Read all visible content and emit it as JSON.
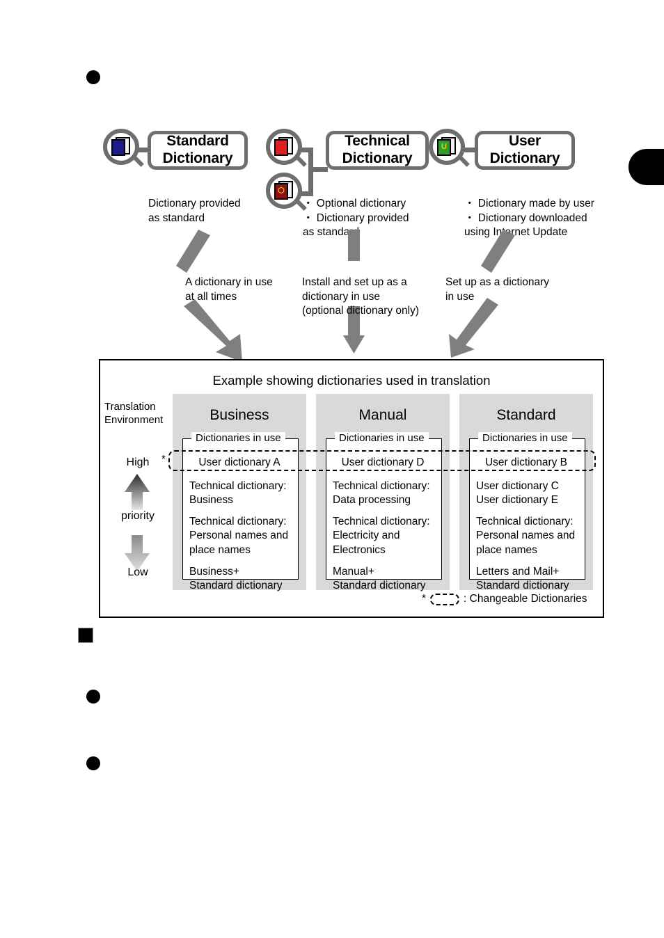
{
  "page": {
    "bullets": [
      {
        "name": "bullet-round-top",
        "shape": "round"
      },
      {
        "name": "bullet-square-mid",
        "shape": "square"
      },
      {
        "name": "bullet-round-lower",
        "shape": "round"
      },
      {
        "name": "bullet-round-bottom",
        "shape": "round"
      }
    ],
    "thumb_tab": ""
  },
  "colors": {
    "callout_border": "#6e6e6e",
    "arrow_grey": "#7f7f7f",
    "column_fill": "#d9d9d9",
    "panel_border": "#000000",
    "standard_book": "#1c1c8c",
    "technical_book": "#e02020",
    "optional_book": "#8c1010",
    "user_book": "#2f9c2f"
  },
  "dictionaries": [
    {
      "id": "standard",
      "title": "Standard\nDictionary",
      "icons": [
        {
          "name": "standard-dictionary-icon",
          "color": "#1c1c8c",
          "glyph": ""
        }
      ],
      "description": "Dictionary provided\nas standard",
      "arrow_label": "A dictionary in use\nat all times"
    },
    {
      "id": "technical",
      "title": "Technical\nDictionary",
      "icons": [
        {
          "name": "technical-dictionary-icon",
          "color": "#e02020",
          "glyph": ""
        },
        {
          "name": "optional-dictionary-icon",
          "color": "#8c1010",
          "glyph": "⬡"
        }
      ],
      "description": "・ Optional dictionary\n・ Dictionary provided\n   as standard",
      "arrow_label": "Install and set up as a\ndictionary in use\n(optional dictionary only)"
    },
    {
      "id": "user",
      "title": "User\nDictionary",
      "icons": [
        {
          "name": "user-dictionary-icon",
          "color": "#2f9c2f",
          "glyph": "U"
        }
      ],
      "description": "・ Dictionary made by user\n・ Dictionary downloaded\n   using Internet Update",
      "arrow_label": "Set up as a dictionary\nin use"
    }
  ],
  "panel": {
    "title": "Example showing dictionaries used in translation",
    "environment_label": "Translation\nEnvironment",
    "priority": {
      "high_label": "High",
      "mid_label": "priority",
      "low_label": "Low"
    },
    "star_marker": "*",
    "legend": {
      "star": "*",
      "text": ": Changeable Dictionaries"
    },
    "columns": [
      {
        "name": "business",
        "title": "Business",
        "group_label": "Dictionaries in use",
        "changeable": "User dictionary A",
        "entries": [
          "Technical dictionary:\nBusiness",
          "Technical dictionary:\nPersonal names and\nplace names",
          "Business+\nStandard dictionary"
        ]
      },
      {
        "name": "manual",
        "title": "Manual",
        "group_label": "Dictionaries in use",
        "changeable": "User dictionary D",
        "entries": [
          "Technical dictionary:\nData processing",
          "Technical dictionary:\nElectricity and\nElectronics",
          "Manual+\nStandard dictionary"
        ]
      },
      {
        "name": "standard",
        "title": "Standard",
        "group_label": "Dictionaries in use",
        "changeable": "User dictionary B",
        "entries": [
          "User dictionary C\nUser dictionary E",
          "Technical dictionary:\nPersonal names and\nplace names",
          "Letters and Mail+\nStandard dictionary"
        ]
      }
    ]
  }
}
